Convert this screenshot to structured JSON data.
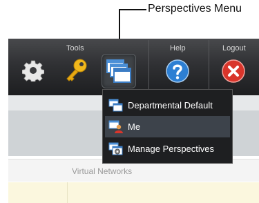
{
  "callout": {
    "label": "Perspectives Menu"
  },
  "toolbar": {
    "sections": [
      {
        "label": "Tools",
        "icons": [
          "gear-icon",
          "key-icon",
          "perspectives-icon"
        ]
      },
      {
        "label": "Help",
        "icons": [
          "help-icon"
        ]
      },
      {
        "label": "Logout",
        "icons": [
          "logout-icon"
        ]
      }
    ]
  },
  "perspectives_menu": {
    "items": [
      {
        "label": "Departmental Default",
        "icon": "windows-icon",
        "active": false
      },
      {
        "label": "Me",
        "icon": "user-perspective-icon",
        "active": true
      },
      {
        "label": "Manage Perspectives",
        "icon": "manage-perspectives-icon",
        "active": false
      }
    ]
  },
  "table": {
    "header": "Virtual Networks"
  },
  "colors": {
    "toolbar_bg": "#303134",
    "menu_bg": "#1e1f21",
    "menu_active": "#3d434b",
    "help": "#2d7fd3",
    "logout": "#d9352b",
    "key": "#f1b81c"
  }
}
